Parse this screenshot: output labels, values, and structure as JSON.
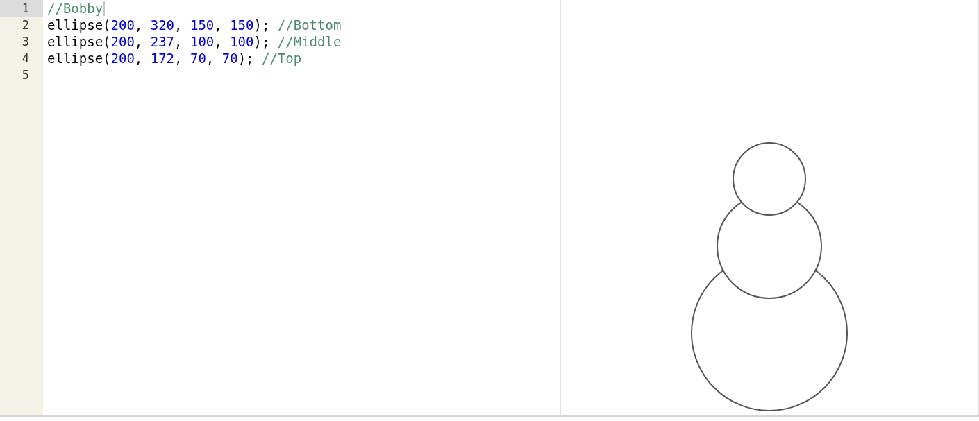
{
  "editor": {
    "lines": [
      {
        "number": "1",
        "active": true,
        "tokens": [
          {
            "kind": "comment",
            "text": "//Bobby"
          }
        ]
      },
      {
        "number": "2",
        "active": false,
        "tokens": [
          {
            "kind": "plain",
            "text": "ellipse("
          },
          {
            "kind": "number",
            "text": "200"
          },
          {
            "kind": "plain",
            "text": ", "
          },
          {
            "kind": "number",
            "text": "320"
          },
          {
            "kind": "plain",
            "text": ", "
          },
          {
            "kind": "number",
            "text": "150"
          },
          {
            "kind": "plain",
            "text": ", "
          },
          {
            "kind": "number",
            "text": "150"
          },
          {
            "kind": "plain",
            "text": "); "
          },
          {
            "kind": "comment",
            "text": "//Bottom"
          }
        ]
      },
      {
        "number": "3",
        "active": false,
        "tokens": [
          {
            "kind": "plain",
            "text": "ellipse("
          },
          {
            "kind": "number",
            "text": "200"
          },
          {
            "kind": "plain",
            "text": ", "
          },
          {
            "kind": "number",
            "text": "237"
          },
          {
            "kind": "plain",
            "text": ", "
          },
          {
            "kind": "number",
            "text": "100"
          },
          {
            "kind": "plain",
            "text": ", "
          },
          {
            "kind": "number",
            "text": "100"
          },
          {
            "kind": "plain",
            "text": "); "
          },
          {
            "kind": "comment",
            "text": "//Middle"
          }
        ]
      },
      {
        "number": "4",
        "active": false,
        "tokens": [
          {
            "kind": "plain",
            "text": "ellipse("
          },
          {
            "kind": "number",
            "text": "200"
          },
          {
            "kind": "plain",
            "text": ", "
          },
          {
            "kind": "number",
            "text": "172"
          },
          {
            "kind": "plain",
            "text": ", "
          },
          {
            "kind": "number",
            "text": "70"
          },
          {
            "kind": "plain",
            "text": ", "
          },
          {
            "kind": "number",
            "text": "70"
          },
          {
            "kind": "plain",
            "text": "); "
          },
          {
            "kind": "comment",
            "text": "//Top"
          }
        ]
      },
      {
        "number": "5",
        "active": false
      }
    ]
  }
}
